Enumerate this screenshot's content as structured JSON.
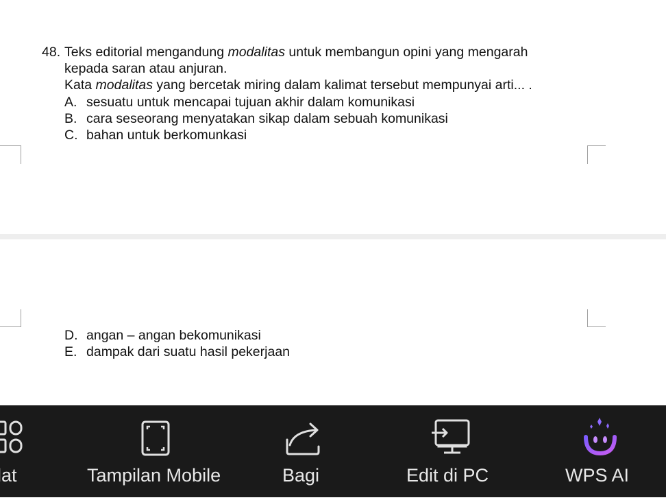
{
  "question": {
    "number": "48.",
    "line1_before": "Teks editorial mengandung ",
    "line1_italic": "modalitas",
    "line1_after": " untuk membangun opini yang mengarah",
    "line2": "kepada saran atau anjuran.",
    "line3_before": "Kata ",
    "line3_italic": "modalitas",
    "line3_after": " yang bercetak miring dalam kalimat tersebut mempunyai arti... .",
    "options": [
      {
        "letter": "A.",
        "text": "sesuatu untuk mencapai tujuan akhir dalam komunikasi"
      },
      {
        "letter": "B.",
        "text": "cara seseorang menyatakan sikap dalam sebuah komunikasi"
      },
      {
        "letter": "C.",
        "text": "bahan untuk berkomunkasi"
      },
      {
        "letter": "D.",
        "text": "angan – angan bekomunikasi"
      },
      {
        "letter": "E.",
        "text": "dampak dari suatu hasil pekerjaan"
      }
    ]
  },
  "toolbar": {
    "items": [
      {
        "label": "lat",
        "icon": "tools-grid-icon"
      },
      {
        "label": "Tampilan Mobile",
        "icon": "mobile-view-icon"
      },
      {
        "label": "Bagi",
        "icon": "share-icon"
      },
      {
        "label": "Edit di PC",
        "icon": "edit-on-pc-icon"
      },
      {
        "label": "WPS AI",
        "icon": "wps-ai-icon"
      }
    ]
  },
  "colors": {
    "toolbar_bg": "#1a1a1a",
    "toolbar_text": "#e8e8e8",
    "ai_gradient_start": "#7c5cff",
    "ai_gradient_end": "#c85cf0"
  }
}
